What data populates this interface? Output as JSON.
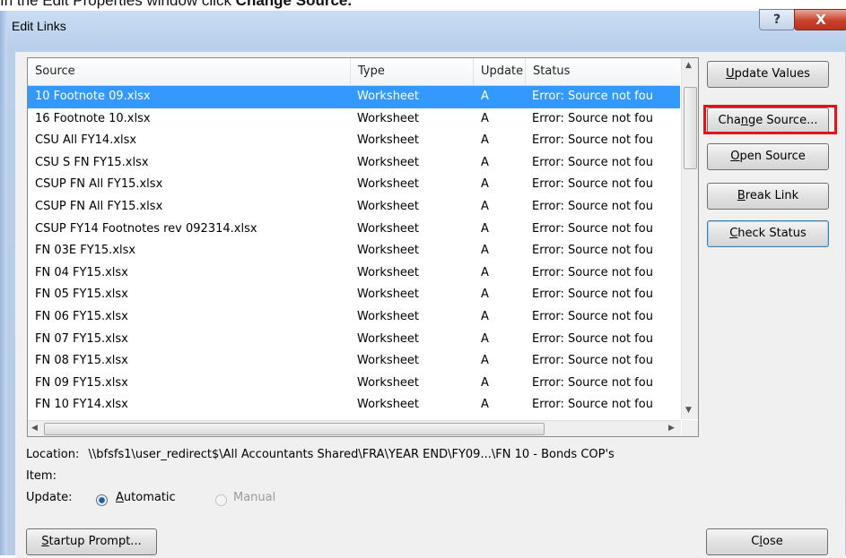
{
  "instruction": {
    "prefix": "In the Edit Properties window click ",
    "bold": "Change Source."
  },
  "window": {
    "title": "Edit Links",
    "help_label": "?",
    "close_label": "X"
  },
  "list": {
    "headers": [
      "Source",
      "Type",
      "Update",
      "Status"
    ],
    "rows": [
      {
        "source": "10 Footnote 09.xlsx",
        "type": "Worksheet",
        "update": "A",
        "status": "Error: Source not fou",
        "selected": true
      },
      {
        "source": "16 Footnote 10.xlsx",
        "type": "Worksheet",
        "update": "A",
        "status": "Error: Source not fou"
      },
      {
        "source": "CSU All FY14.xlsx",
        "type": "Worksheet",
        "update": "A",
        "status": "Error: Source not fou"
      },
      {
        "source": "CSU S FN FY15.xlsx",
        "type": "Worksheet",
        "update": "A",
        "status": "Error: Source not fou"
      },
      {
        "source": "CSUP FN All FY15.xlsx",
        "type": "Worksheet",
        "update": "A",
        "status": "Error: Source not fou"
      },
      {
        "source": "CSUP FN All FY15.xlsx",
        "type": "Worksheet",
        "update": "A",
        "status": "Error: Source not fou"
      },
      {
        "source": "CSUP FY14 Footnotes rev 092314.xlsx",
        "type": "Worksheet",
        "update": "A",
        "status": "Error: Source not fou"
      },
      {
        "source": "FN 03E FY15.xlsx",
        "type": "Worksheet",
        "update": "A",
        "status": "Error: Source not fou"
      },
      {
        "source": "FN 04 FY15.xlsx",
        "type": "Worksheet",
        "update": "A",
        "status": "Error: Source not fou"
      },
      {
        "source": "FN 05 FY15.xlsx",
        "type": "Worksheet",
        "update": "A",
        "status": "Error: Source not fou"
      },
      {
        "source": "FN 06 FY15.xlsx",
        "type": "Worksheet",
        "update": "A",
        "status": "Error: Source not fou"
      },
      {
        "source": "FN 07 FY15.xlsx",
        "type": "Worksheet",
        "update": "A",
        "status": "Error: Source not fou"
      },
      {
        "source": "FN 08 FY15.xlsx",
        "type": "Worksheet",
        "update": "A",
        "status": "Error: Source not fou"
      },
      {
        "source": "FN 09 FY15.xlsx",
        "type": "Worksheet",
        "update": "A",
        "status": "Error: Source not fou"
      },
      {
        "source": "FN 10 FY14.xlsx",
        "type": "Worksheet",
        "update": "A",
        "status": "Error: Source not fou"
      }
    ]
  },
  "buttons": {
    "update_values": {
      "pre": "",
      "key": "U",
      "post": "pdate Values"
    },
    "change_source": {
      "pre": "Cha",
      "key": "n",
      "post": "ge Source..."
    },
    "open_source": {
      "pre": "",
      "key": "O",
      "post": "pen Source"
    },
    "break_link": {
      "pre": "",
      "key": "B",
      "post": "reak Link"
    },
    "check_status": {
      "pre": "",
      "key": "C",
      "post": "heck Status"
    },
    "startup_prompt": {
      "pre": "",
      "key": "S",
      "post": "tartup Prompt..."
    },
    "close": {
      "pre": "C",
      "key": "l",
      "post": "ose"
    }
  },
  "details": {
    "location_label": "Location:",
    "location_value": "\\\\bfsfs1\\user_redirect$\\All Accountants Shared\\FRA\\YEAR END\\FY09...\\FN 10 - Bonds COP's",
    "item_label": "Item:",
    "update_label": "Update:",
    "automatic_key": "A",
    "automatic_rest": "utomatic",
    "manual_label": "Manual"
  },
  "colors": {
    "selection": "#3399ff",
    "highlight_border": "#e8101a"
  }
}
